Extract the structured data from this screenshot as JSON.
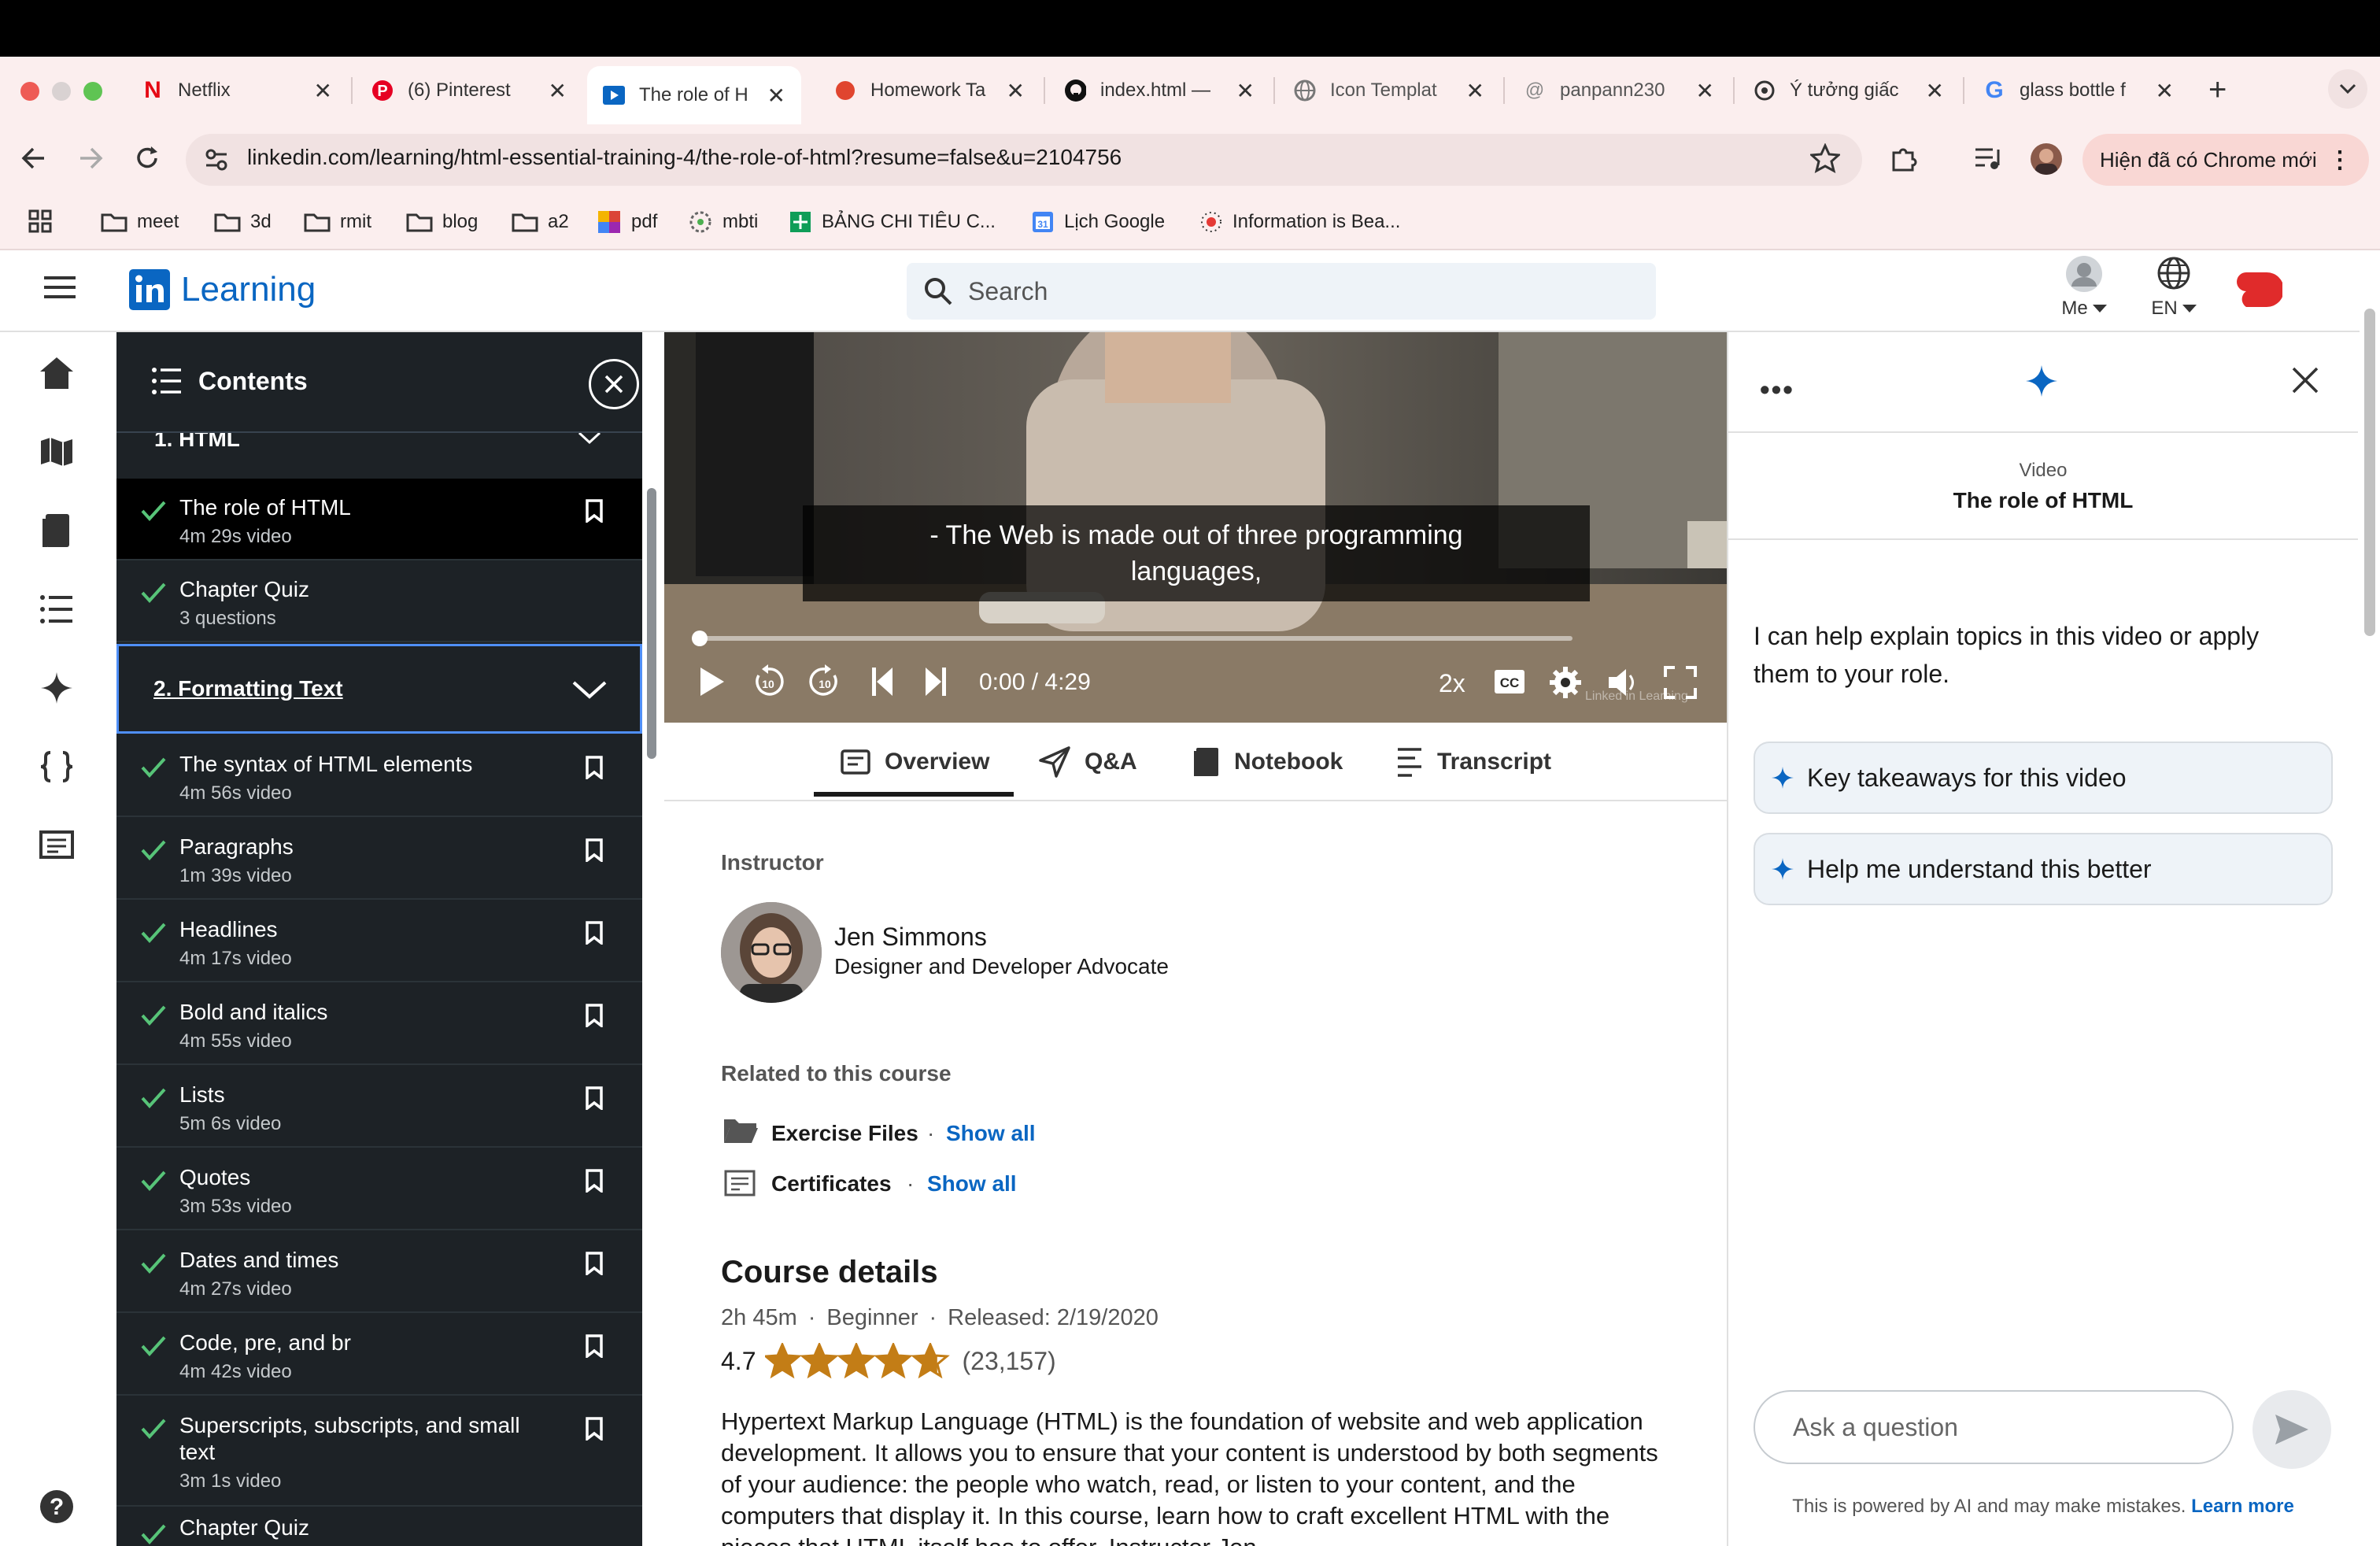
{
  "browser": {
    "tabs": [
      {
        "title": "Netflix",
        "icon": "netflix-icon"
      },
      {
        "title": "(6) Pinterest",
        "icon": "pinterest-icon"
      },
      {
        "title": "The role of H",
        "icon": "linkedin-icon"
      },
      {
        "title": "Homework Ta",
        "icon": "homework-icon"
      },
      {
        "title": "index.html —",
        "icon": "github-icon"
      },
      {
        "title": "Icon Templat",
        "icon": "globe-icon"
      },
      {
        "title": "panpann230",
        "icon": "threads-icon"
      },
      {
        "title": "Ý tưởng giấc",
        "icon": "openai-icon"
      },
      {
        "title": "glass bottle f",
        "icon": "google-icon"
      }
    ],
    "url": "linkedin.com/learning/html-essential-training-4/the-role-of-html?resume=false&u=2104756",
    "update_label": "Hiện đã có Chrome mới",
    "bookmarks": [
      {
        "label": "meet",
        "icon": "folder-icon"
      },
      {
        "label": "3d",
        "icon": "folder-icon"
      },
      {
        "label": "rmit",
        "icon": "folder-icon"
      },
      {
        "label": "blog",
        "icon": "folder-icon"
      },
      {
        "label": "a2",
        "icon": "folder-icon"
      },
      {
        "label": "pdf",
        "icon": "pdf-icon"
      },
      {
        "label": "mbti",
        "icon": "mbti-icon"
      },
      {
        "label": "BẢNG CHI TIÊU C...",
        "icon": "sheets-icon"
      },
      {
        "label": "Lịch Google",
        "icon": "calendar-icon"
      },
      {
        "label": "Information is Bea...",
        "icon": "info-icon"
      }
    ]
  },
  "header": {
    "logo_text": "Learning",
    "search_placeholder": "Search",
    "me_label": "Me",
    "lang_label": "EN"
  },
  "contents": {
    "title": "Contents",
    "chapter1": "1. HTML",
    "chapter2": "2. Formatting Text",
    "items": [
      {
        "title": "The role of HTML",
        "sub": "4m 29s video",
        "bookmark": true
      },
      {
        "title": "Chapter Quiz",
        "sub": "3 questions",
        "bookmark": false
      },
      {
        "title": "The syntax of HTML elements",
        "sub": "4m 56s video",
        "bookmark": true
      },
      {
        "title": "Paragraphs",
        "sub": "1m 39s video",
        "bookmark": true
      },
      {
        "title": "Headlines",
        "sub": "4m 17s video",
        "bookmark": true
      },
      {
        "title": "Bold and italics",
        "sub": "4m 55s video",
        "bookmark": true
      },
      {
        "title": "Lists",
        "sub": "5m 6s video",
        "bookmark": true
      },
      {
        "title": "Quotes",
        "sub": "3m 53s video",
        "bookmark": true
      },
      {
        "title": "Dates and times",
        "sub": "4m 27s video",
        "bookmark": true
      },
      {
        "title": "Code, pre, and br",
        "sub": "4m 42s video",
        "bookmark": true
      },
      {
        "title": "Superscripts, subscripts, and small text",
        "sub": "3m 1s video",
        "bookmark": true
      },
      {
        "title": "Chapter Quiz",
        "sub": "",
        "bookmark": false
      }
    ]
  },
  "video": {
    "caption": "- The Web is made out of three programming languages,",
    "time": "0:00 / 4:29",
    "speed": "2x",
    "watermark": "Linked in Learning",
    "progress": 0
  },
  "video_tabs": [
    "Overview",
    "Q&A",
    "Notebook",
    "Transcript"
  ],
  "overview": {
    "instructor_label": "Instructor",
    "instructor_name": "Jen Simmons",
    "instructor_role": "Designer and Developer Advocate",
    "related_label": "Related to this course",
    "exercise_files": "Exercise Files",
    "certificates": "Certificates",
    "show_all": "Show all",
    "details_title": "Course details",
    "duration": "2h 45m",
    "level": "Beginner",
    "released": "Released: 2/19/2020",
    "rating": "4.7",
    "rating_stars": 4.7,
    "rating_count": "(23,157)",
    "description": "Hypertext Markup Language (HTML) is the foundation of website and web application development. It allows you to ensure that your content is understood by both segments of your audience: the people who watch, read, or listen to your content, and the computers that display it. In this course, learn how to craft excellent HTML with the pieces that HTML itself has to offer. Instructor Jen"
  },
  "ai": {
    "context_label": "Video",
    "context_title": "The role of HTML",
    "intro": "I can help explain topics in this video or apply them to your role.",
    "suggestions": [
      "Key takeaways for this video",
      "Help me understand this better"
    ],
    "input_placeholder": "Ask a question",
    "disclaimer": "This is powered by AI and may make mistakes.",
    "learn_more": "Learn more"
  },
  "colors": {
    "linkedin_blue": "#0a66c2",
    "check_green": "#57c478",
    "sidebar_bg": "#1d2226",
    "star": "#c37d16",
    "chrome_bg": "#fbeeee"
  }
}
